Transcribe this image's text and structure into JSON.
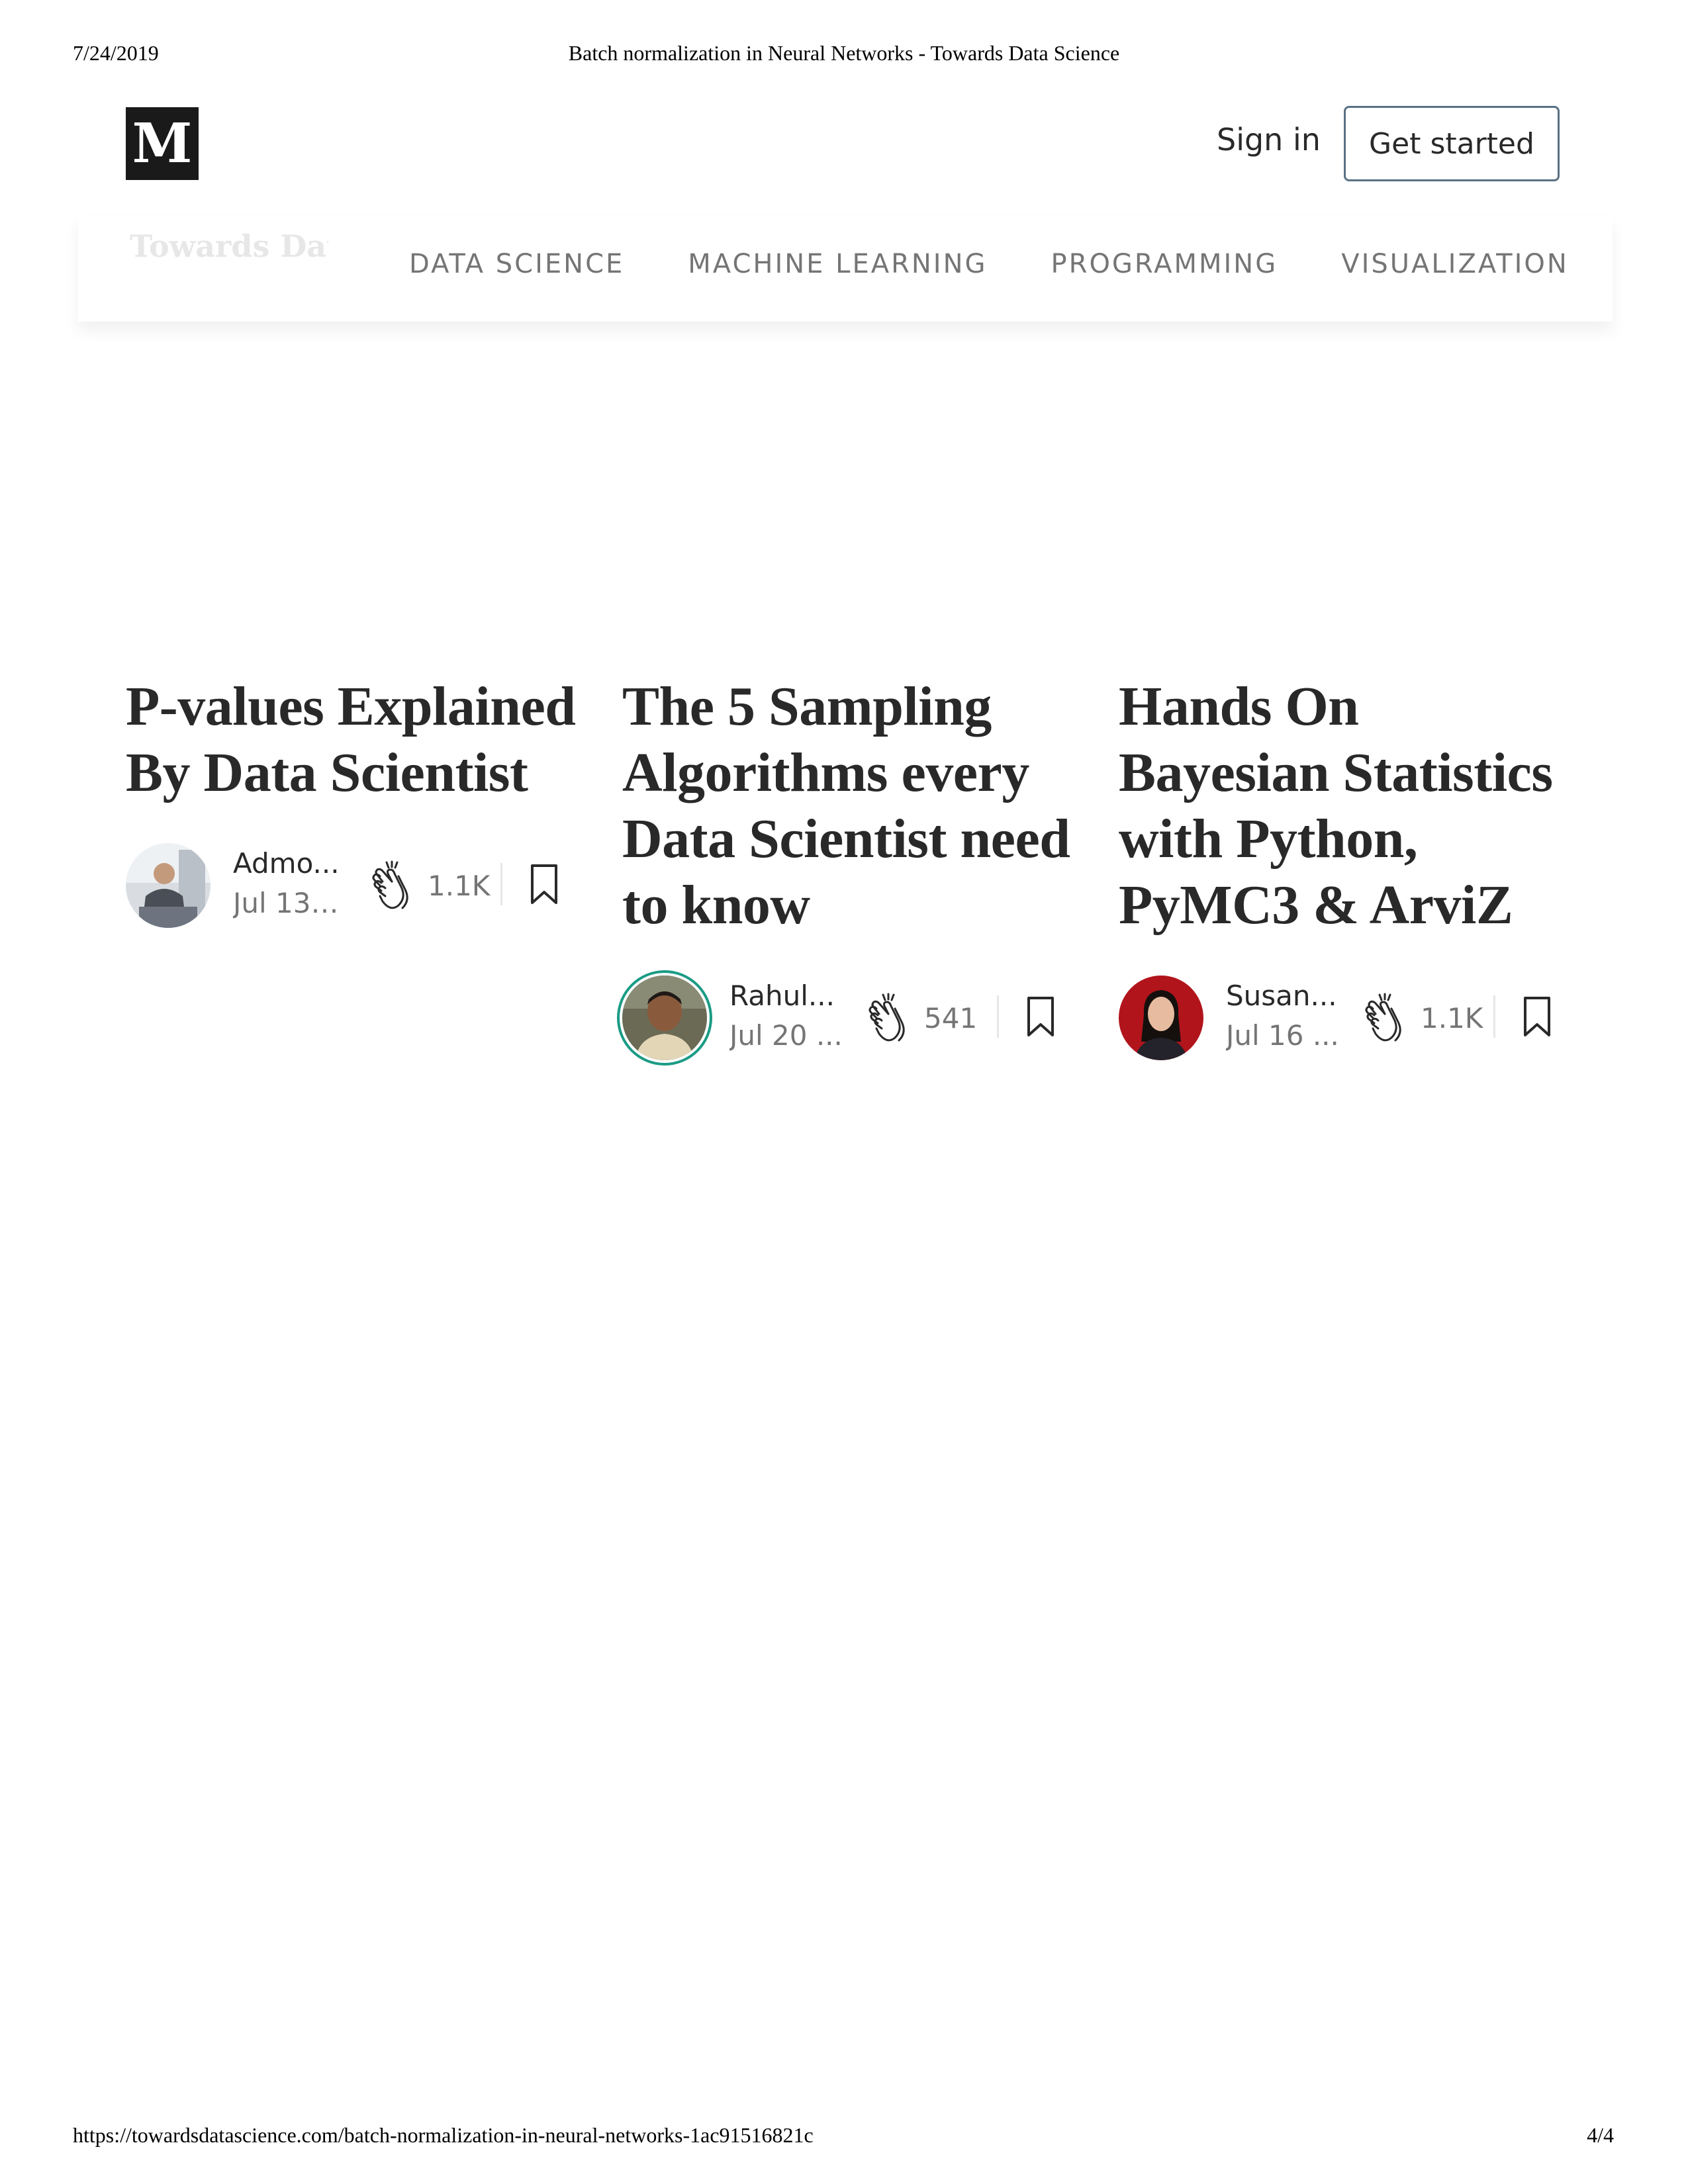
{
  "print_header": {
    "date": "7/24/2019",
    "title": "Batch normalization in Neural Networks - Towards Data Science"
  },
  "print_footer": {
    "url": "https://towardsdatascience.com/batch-normalization-in-neural-networks-1ac91516821c",
    "page": "4/4"
  },
  "topbar": {
    "logo": "M",
    "sign_in": "Sign in",
    "get_started": "Get started",
    "faded_publication": "Towards Data Science"
  },
  "nav": {
    "items": [
      {
        "label": "DATA SCIENCE"
      },
      {
        "label": "MACHINE LEARNING"
      },
      {
        "label": "PROGRAMMING"
      },
      {
        "label": "VISUALIZATION"
      }
    ]
  },
  "cards": [
    {
      "title": "P-values Explained By Data Scientist",
      "author": "Admo...",
      "date": "Jul 13 ·...",
      "claps": "1.1K"
    },
    {
      "title": "The 5 Sampling Algorithms every Data Scientist need to know",
      "author": "Rahul...",
      "date": "Jul 20 ...",
      "claps": "541"
    },
    {
      "title": "Hands On Bayesian Statistics with Python, PyMC3 & ArviZ",
      "author": "Susan...",
      "date": "Jul 16 ...",
      "claps": "1.1K"
    }
  ],
  "icons": {
    "clap": "clap-icon",
    "bookmark": "bookmark-icon"
  },
  "colors": {
    "text": "#292929",
    "muted": "#757575",
    "button_border": "#5a7184",
    "avatar_ring": "#1b9b85"
  }
}
